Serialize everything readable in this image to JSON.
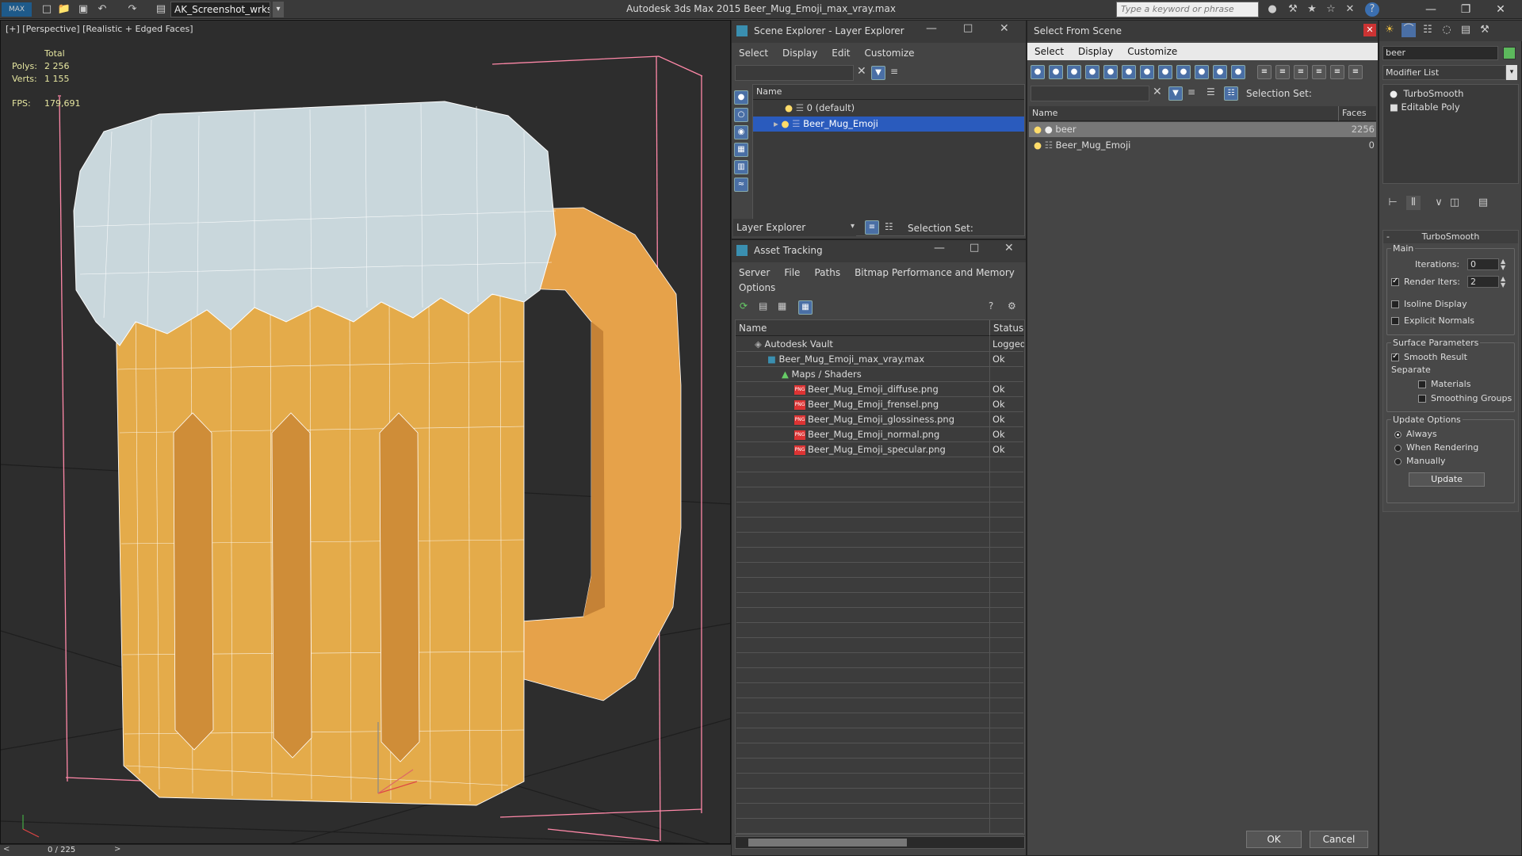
{
  "titlebar": {
    "workspace": "AK_Screenshot_wrksp",
    "app_title": "Autodesk 3ds Max  2015     Beer_Mug_Emoji_max_vray.max",
    "search_placeholder": "Type a keyword or phrase"
  },
  "viewport": {
    "label": "[+] [Perspective] [Realistic + Edged Faces]",
    "stats": {
      "total_label": "Total",
      "polys_label": "Polys:",
      "polys_value": "2 256",
      "verts_label": "Verts:",
      "verts_value": "1 155",
      "fps_label": "FPS:",
      "fps_value": "179,691"
    }
  },
  "timeline": {
    "frame": "0 / 225",
    "prev": "<",
    "next": ">"
  },
  "scene_explorer": {
    "title": "Scene Explorer - Layer Explorer",
    "menu": [
      "Select",
      "Display",
      "Edit",
      "Customize"
    ],
    "col_name": "Name",
    "rows": [
      "0 (default)",
      "Beer_Mug_Emoji"
    ],
    "footer_dropdown": "Layer Explorer",
    "footer_selection": "Selection Set:"
  },
  "asset_tracking": {
    "title": "Asset Tracking",
    "menu1": [
      "Server",
      "File",
      "Paths",
      "Bitmap Performance and Memory"
    ],
    "menu2": [
      "Options"
    ],
    "col_name": "Name",
    "col_status": "Status",
    "rows": [
      {
        "name": "Autodesk Vault",
        "status": "Logged"
      },
      {
        "name": "Beer_Mug_Emoji_max_vray.max",
        "status": "Ok"
      },
      {
        "name": "Maps / Shaders",
        "status": ""
      },
      {
        "name": "Beer_Mug_Emoji_diffuse.png",
        "status": "Ok"
      },
      {
        "name": "Beer_Mug_Emoji_frensel.png",
        "status": "Ok"
      },
      {
        "name": "Beer_Mug_Emoji_glossiness.png",
        "status": "Ok"
      },
      {
        "name": "Beer_Mug_Emoji_normal.png",
        "status": "Ok"
      },
      {
        "name": "Beer_Mug_Emoji_specular.png",
        "status": "Ok"
      }
    ],
    "png_tag": "PNG"
  },
  "select_from_scene": {
    "title": "Select From Scene",
    "menu": [
      "Select",
      "Display",
      "Customize"
    ],
    "selection_set": "Selection Set:",
    "col_name": "Name",
    "col_faces": "Faces",
    "rows": [
      {
        "name": "beer",
        "faces": "2256"
      },
      {
        "name": "Beer_Mug_Emoji",
        "faces": "0"
      }
    ],
    "ok": "OK",
    "cancel": "Cancel"
  },
  "command_panel": {
    "name_field": "beer",
    "modifier_list": "Modifier List",
    "stack": [
      "TurboSmooth",
      "Editable Poly"
    ],
    "rollout_title": "TurboSmooth",
    "main_label": "Main",
    "iterations_label": "Iterations:",
    "iterations_value": "0",
    "render_iters_label": "Render Iters:",
    "render_iters_value": "2",
    "isoline": "Isoline Display",
    "explicit": "Explicit Normals",
    "surface_label": "Surface Parameters",
    "smooth_result": "Smooth Result",
    "separate": "Separate",
    "materials": "Materials",
    "smoothing_groups": "Smoothing Groups",
    "update_options": "Update Options",
    "always": "Always",
    "when_rendering": "When Rendering",
    "manually": "Manually",
    "update_btn": "Update"
  },
  "colors": {
    "selection": "#2a5bbd",
    "mug": "#e8a84a",
    "foam": "#c9d7dc"
  }
}
